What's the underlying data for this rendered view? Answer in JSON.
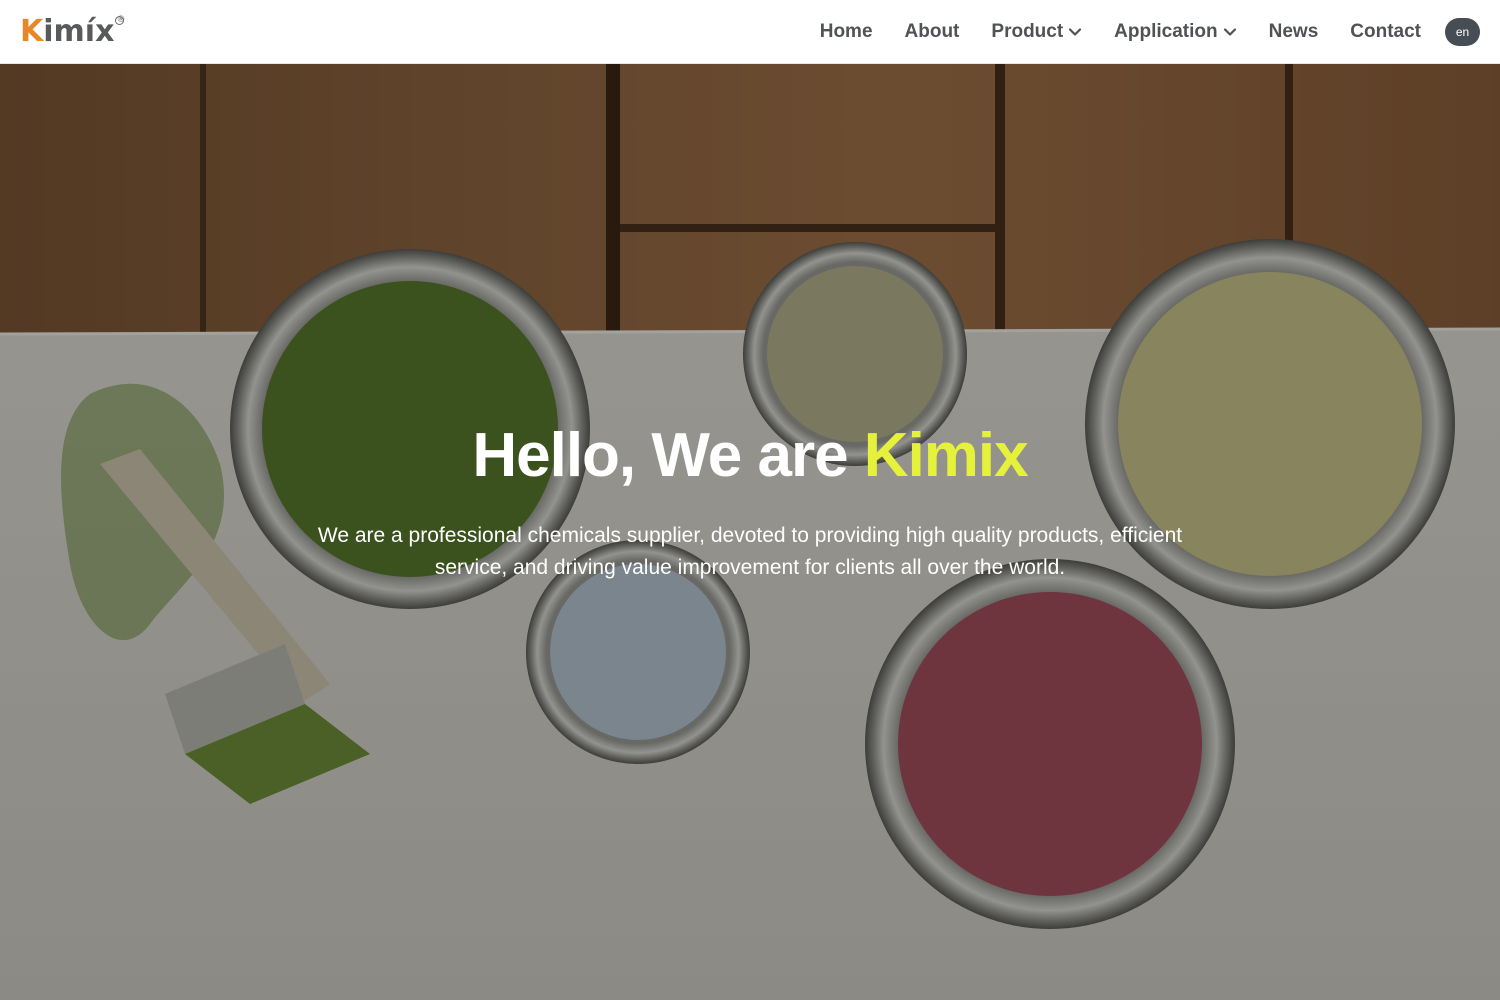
{
  "brand": {
    "logo_initial": "K",
    "logo_rest": "imíx",
    "logo_mark": "®",
    "colors": {
      "logo_orange": "#e8862a",
      "logo_gray": "#595a5c"
    }
  },
  "nav": {
    "home": "Home",
    "about": "About",
    "product": "Product",
    "application": "Application",
    "news": "News",
    "contact": "Contact",
    "language": "en",
    "dropdown_icon": "chevron-down-icon"
  },
  "hero": {
    "title_prefix": "Hello, We are ",
    "title_accent": "Kimix",
    "subtitle": "We are a professional chemicals supplier, devoted to providing high quality products, efficient service, and driving value improvement for clients all over the world.",
    "colors": {
      "accent": "#e6f13b",
      "text": "#ffffff"
    }
  }
}
